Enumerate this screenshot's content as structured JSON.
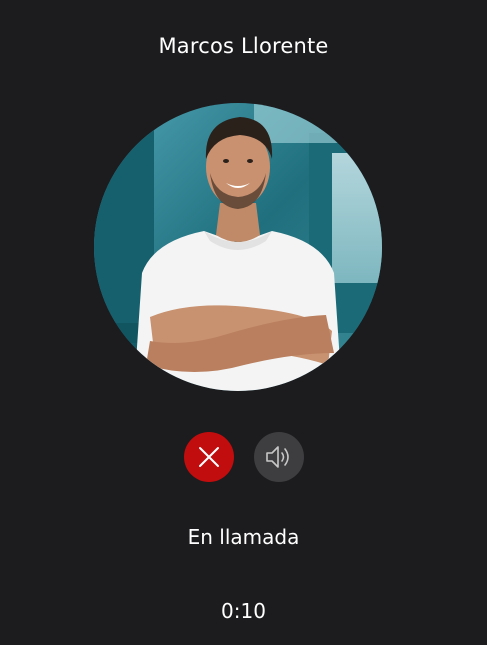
{
  "call": {
    "caller_name": "Marcos Llorente",
    "status": "En llamada",
    "timer": "0:10"
  },
  "avatar": {
    "description_icon": "person-photo"
  },
  "controls": {
    "hangup_icon": "close-icon",
    "speaker_icon": "speaker-icon"
  },
  "colors": {
    "background": "#1c1b1e",
    "hangup": "#c10d0d",
    "speaker": "#3e3e41",
    "text": "#ffffff"
  }
}
